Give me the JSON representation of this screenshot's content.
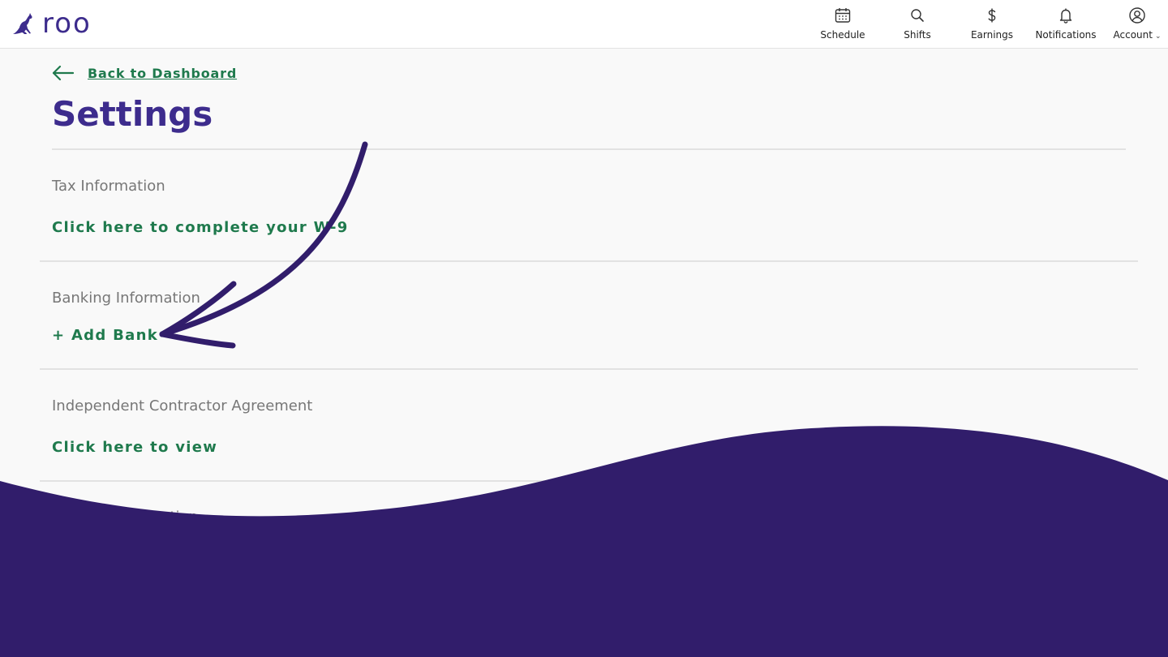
{
  "brand": {
    "name": "roo",
    "color": "#3d2c8d"
  },
  "nav": [
    {
      "label": "Schedule",
      "icon": "calendar-icon"
    },
    {
      "label": "Shifts",
      "icon": "search-icon"
    },
    {
      "label": "Earnings",
      "icon": "dollar-icon"
    },
    {
      "label": "Notifications",
      "icon": "bell-icon"
    },
    {
      "label": "Account",
      "icon": "user-circle-icon"
    }
  ],
  "back_link": {
    "label": "Back to Dashboard"
  },
  "page_title": "Settings",
  "sections": [
    {
      "title": "Tax Information",
      "link": "Click here to complete your W-9"
    },
    {
      "title": "Banking Information",
      "link": "+ Add Bank"
    },
    {
      "title": "Independent Contractor Agreement",
      "link": "Click here to view"
    },
    {
      "title": "Contact Information"
    }
  ],
  "colors": {
    "link_green": "#1f7a4d",
    "accent_purple": "#3d2c8d",
    "overlay_purple": "#311d6b"
  }
}
